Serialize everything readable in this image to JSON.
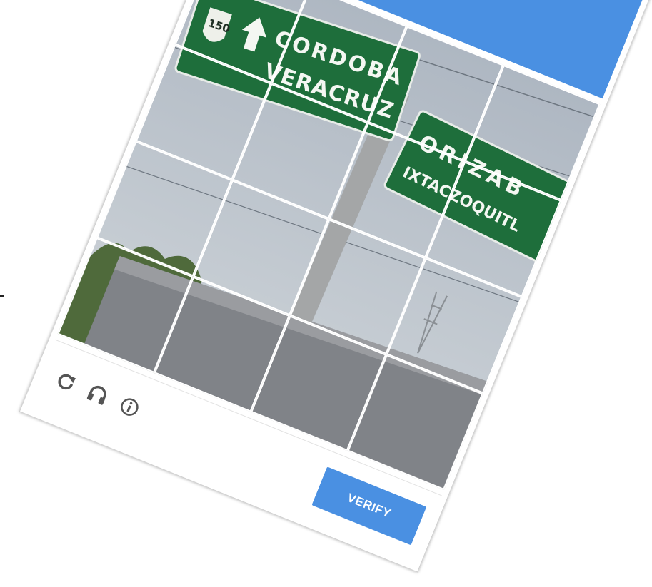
{
  "captcha": {
    "header_color": "#4a90e2",
    "grid": {
      "rows": 4,
      "cols": 4
    },
    "photo": {
      "sign_left": {
        "shield_number": "150",
        "line1": "CORDOBA",
        "line2": "VERACRUZ"
      },
      "sign_right": {
        "line1": "ORIZAB",
        "line2": "IXTACZOQUITL"
      }
    },
    "footer": {
      "reload_icon": "reload-icon",
      "audio_icon": "headphones-icon",
      "info_icon": "info-icon",
      "verify_label": "VERIFY"
    }
  }
}
